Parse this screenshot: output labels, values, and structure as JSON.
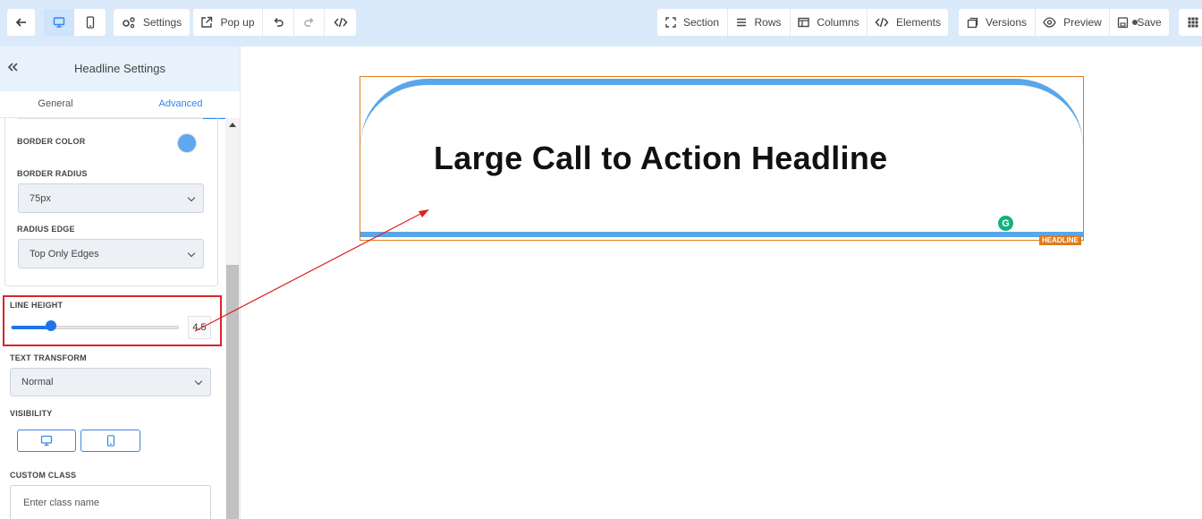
{
  "toolbar": {
    "back_icon": "arrow-left-icon",
    "desktop_icon": "desktop-icon",
    "mobile_icon": "mobile-icon",
    "settings_label": "Settings",
    "popup_label": "Pop up",
    "undo_icon": "undo-icon",
    "redo_icon": "redo-icon",
    "code_icon": "code-icon",
    "section_label": "Section",
    "rows_label": "Rows",
    "columns_label": "Columns",
    "elements_label": "Elements",
    "versions_label": "Versions",
    "preview_label": "Preview",
    "save_label": "Save",
    "apps_icon": "grid-icon"
  },
  "sidebar": {
    "title": "Headline Settings",
    "tabs": [
      "General",
      "Advanced"
    ],
    "active_tab": "Advanced",
    "border_color": {
      "label": "BORDER COLOR",
      "value": "#5fa8ee"
    },
    "border_radius": {
      "label": "BORDER RADIUS",
      "value": "75px"
    },
    "radius_edge": {
      "label": "RADIUS EDGE",
      "value": "Top Only Edges"
    },
    "line_height": {
      "label": "LINE HEIGHT",
      "value": "4.5",
      "fraction": 0.24
    },
    "text_transform": {
      "label": "TEXT TRANSFORM",
      "value": "Normal"
    },
    "visibility": {
      "label": "VISIBILITY"
    },
    "custom_class": {
      "label": "CUSTOM CLASS",
      "placeholder": "Enter class name"
    }
  },
  "canvas": {
    "headline": "Large Call to Action Headline",
    "element_tag": "HEADLINE",
    "grammarly_glyph": "G"
  },
  "colors": {
    "accent": "#2d87f0",
    "highlight": "#d9242a",
    "element_outline": "#e07b1a",
    "border_blue": "#5aa6e8"
  }
}
